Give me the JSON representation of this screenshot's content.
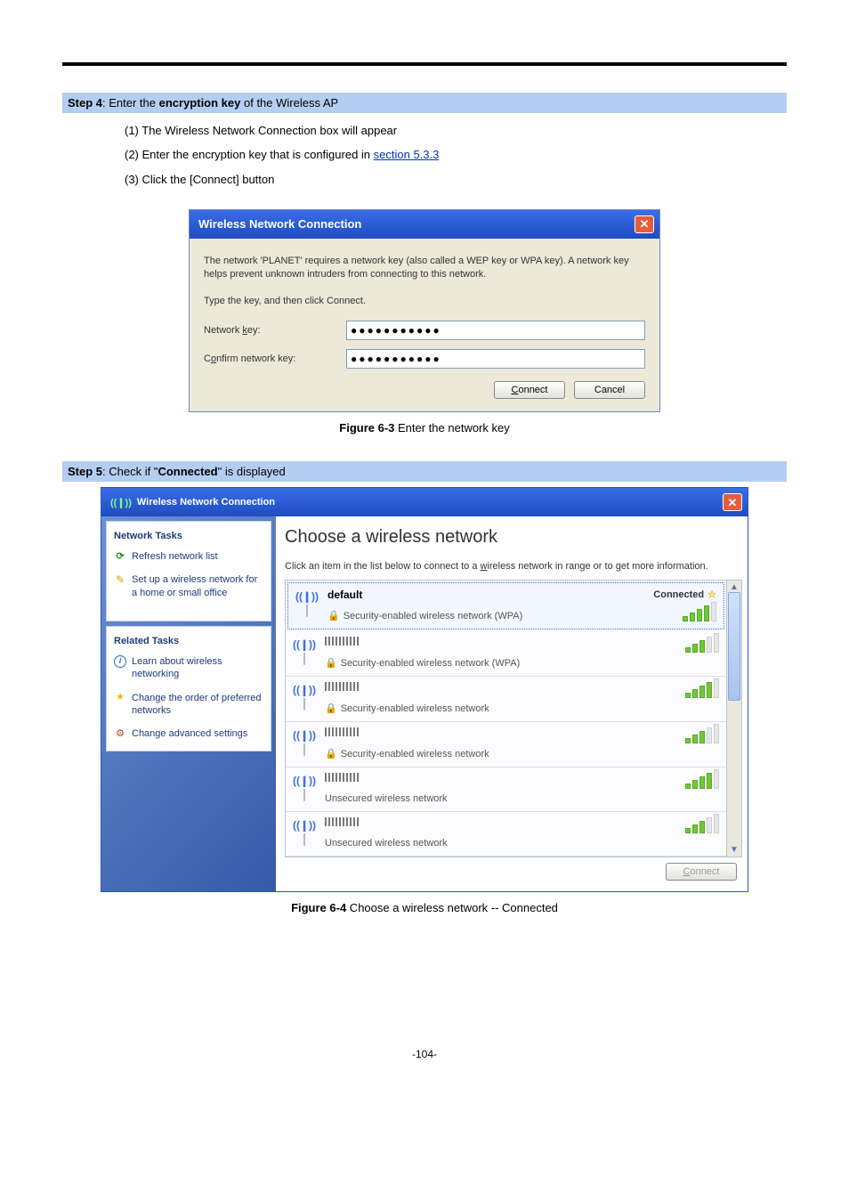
{
  "step4": {
    "label": "Step 4",
    "text_prefix": ": Enter the ",
    "bold": "encryption key",
    "text_suffix": " of the Wireless AP",
    "items": {
      "1": "(1)  The Wireless Network Connection box will appear",
      "2_prefix": "(2)  Enter the encryption key that is configured in ",
      "2_link": "section 5.3.3",
      "3": "(3)  Click the [Connect] button"
    }
  },
  "dialog1": {
    "title": "Wireless Network Connection",
    "para1": "The network 'PLANET' requires a network key (also called a WEP key or WPA key). A network key helps prevent unknown intruders from connecting to this network.",
    "para2": "Type the key, and then click Connect.",
    "label_key_pre": "Network ",
    "label_key_u": "k",
    "label_key_post": "ey:",
    "label_confirm_pre": "C",
    "label_confirm_u": "o",
    "label_confirm_post": "nfirm network key:",
    "key_value": "●●●●●●●●●●●",
    "confirm_value": "●●●●●●●●●●●",
    "connect_u": "C",
    "connect_rest": "onnect",
    "cancel": "Cancel"
  },
  "caption1_bold": "Figure 6-3",
  "caption1_rest": " Enter the network key",
  "step5": {
    "label": "Step 5",
    "text_prefix": ": Check if \"",
    "bold": "Connected",
    "text_suffix": "\" is displayed"
  },
  "dialog2": {
    "title": "Wireless Network Connection",
    "side": {
      "tasks_title": "Network Tasks",
      "refresh": "Refresh network list",
      "setup": "Set up a wireless network for a home or small office",
      "related_title": "Related Tasks",
      "learn": "Learn about wireless networking",
      "order": "Change the order of preferred networks",
      "advanced": "Change advanced settings"
    },
    "main": {
      "heading": "Choose a wireless network",
      "subtext_pre": "Click an item in the list below to connect to a ",
      "subtext_u": "w",
      "subtext_post": "ireless network in range or to get more information.",
      "connected": "Connected",
      "connect_btn_u": "C",
      "connect_btn_rest": "onnect"
    },
    "networks": [
      {
        "name": "default",
        "security": "Security-enabled wireless network (WPA)",
        "locked": true,
        "status": "connected",
        "signal": 4
      },
      {
        "name": "",
        "security": "Security-enabled wireless network (WPA)",
        "locked": true,
        "signal": 3
      },
      {
        "name": "",
        "security": "Security-enabled wireless network",
        "locked": true,
        "signal": 4
      },
      {
        "name": "",
        "security": "Security-enabled wireless network",
        "locked": true,
        "signal": 3
      },
      {
        "name": "",
        "security": "Unsecured wireless network",
        "locked": false,
        "signal": 4
      },
      {
        "name": "",
        "security": "Unsecured wireless network",
        "locked": false,
        "signal": 3
      }
    ]
  },
  "caption2_bold": "Figure 6-4",
  "caption2_rest": " Choose a wireless network -- Connected",
  "page_number": "-104-"
}
